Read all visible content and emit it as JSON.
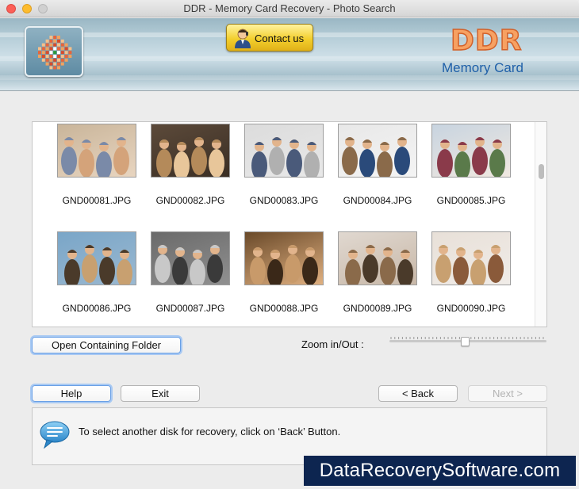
{
  "window": {
    "title": "DDR - Memory Card Recovery - Photo Search"
  },
  "header": {
    "logo_icon": "software-logo-icon",
    "contact_label": "Contact us",
    "contact_icon": "support-person-icon",
    "brand_title": "DDR",
    "brand_subtitle": "Memory Card"
  },
  "thumbnails": [
    {
      "name": "GND00081.JPG"
    },
    {
      "name": "GND00082.JPG"
    },
    {
      "name": "GND00083.JPG"
    },
    {
      "name": "GND00084.JPG"
    },
    {
      "name": "GND00085.JPG"
    },
    {
      "name": "GND00086.JPG"
    },
    {
      "name": "GND00087.JPG"
    },
    {
      "name": "GND00088.JPG"
    },
    {
      "name": "GND00089.JPG"
    },
    {
      "name": "GND00090.JPG"
    }
  ],
  "controls": {
    "open_folder_label": "Open Containing Folder",
    "zoom_label": "Zoom in/Out :",
    "zoom_level": 0.48
  },
  "nav": {
    "help_label": "Help",
    "exit_label": "Exit",
    "back_label": "< Back",
    "next_label": "Next >"
  },
  "info": {
    "icon": "speech-bubble-icon",
    "message": "To select another disk for recovery, click on ‘Back’ Button."
  },
  "watermark": "DataRecoverySoftware.com",
  "colors": {
    "banner": "#b9d0da",
    "brand_orange": "#f7a162",
    "brand_blue": "#1e5fa8",
    "contact_yellow": "#f3cf2d",
    "watermark_bg": "#0d2550"
  }
}
